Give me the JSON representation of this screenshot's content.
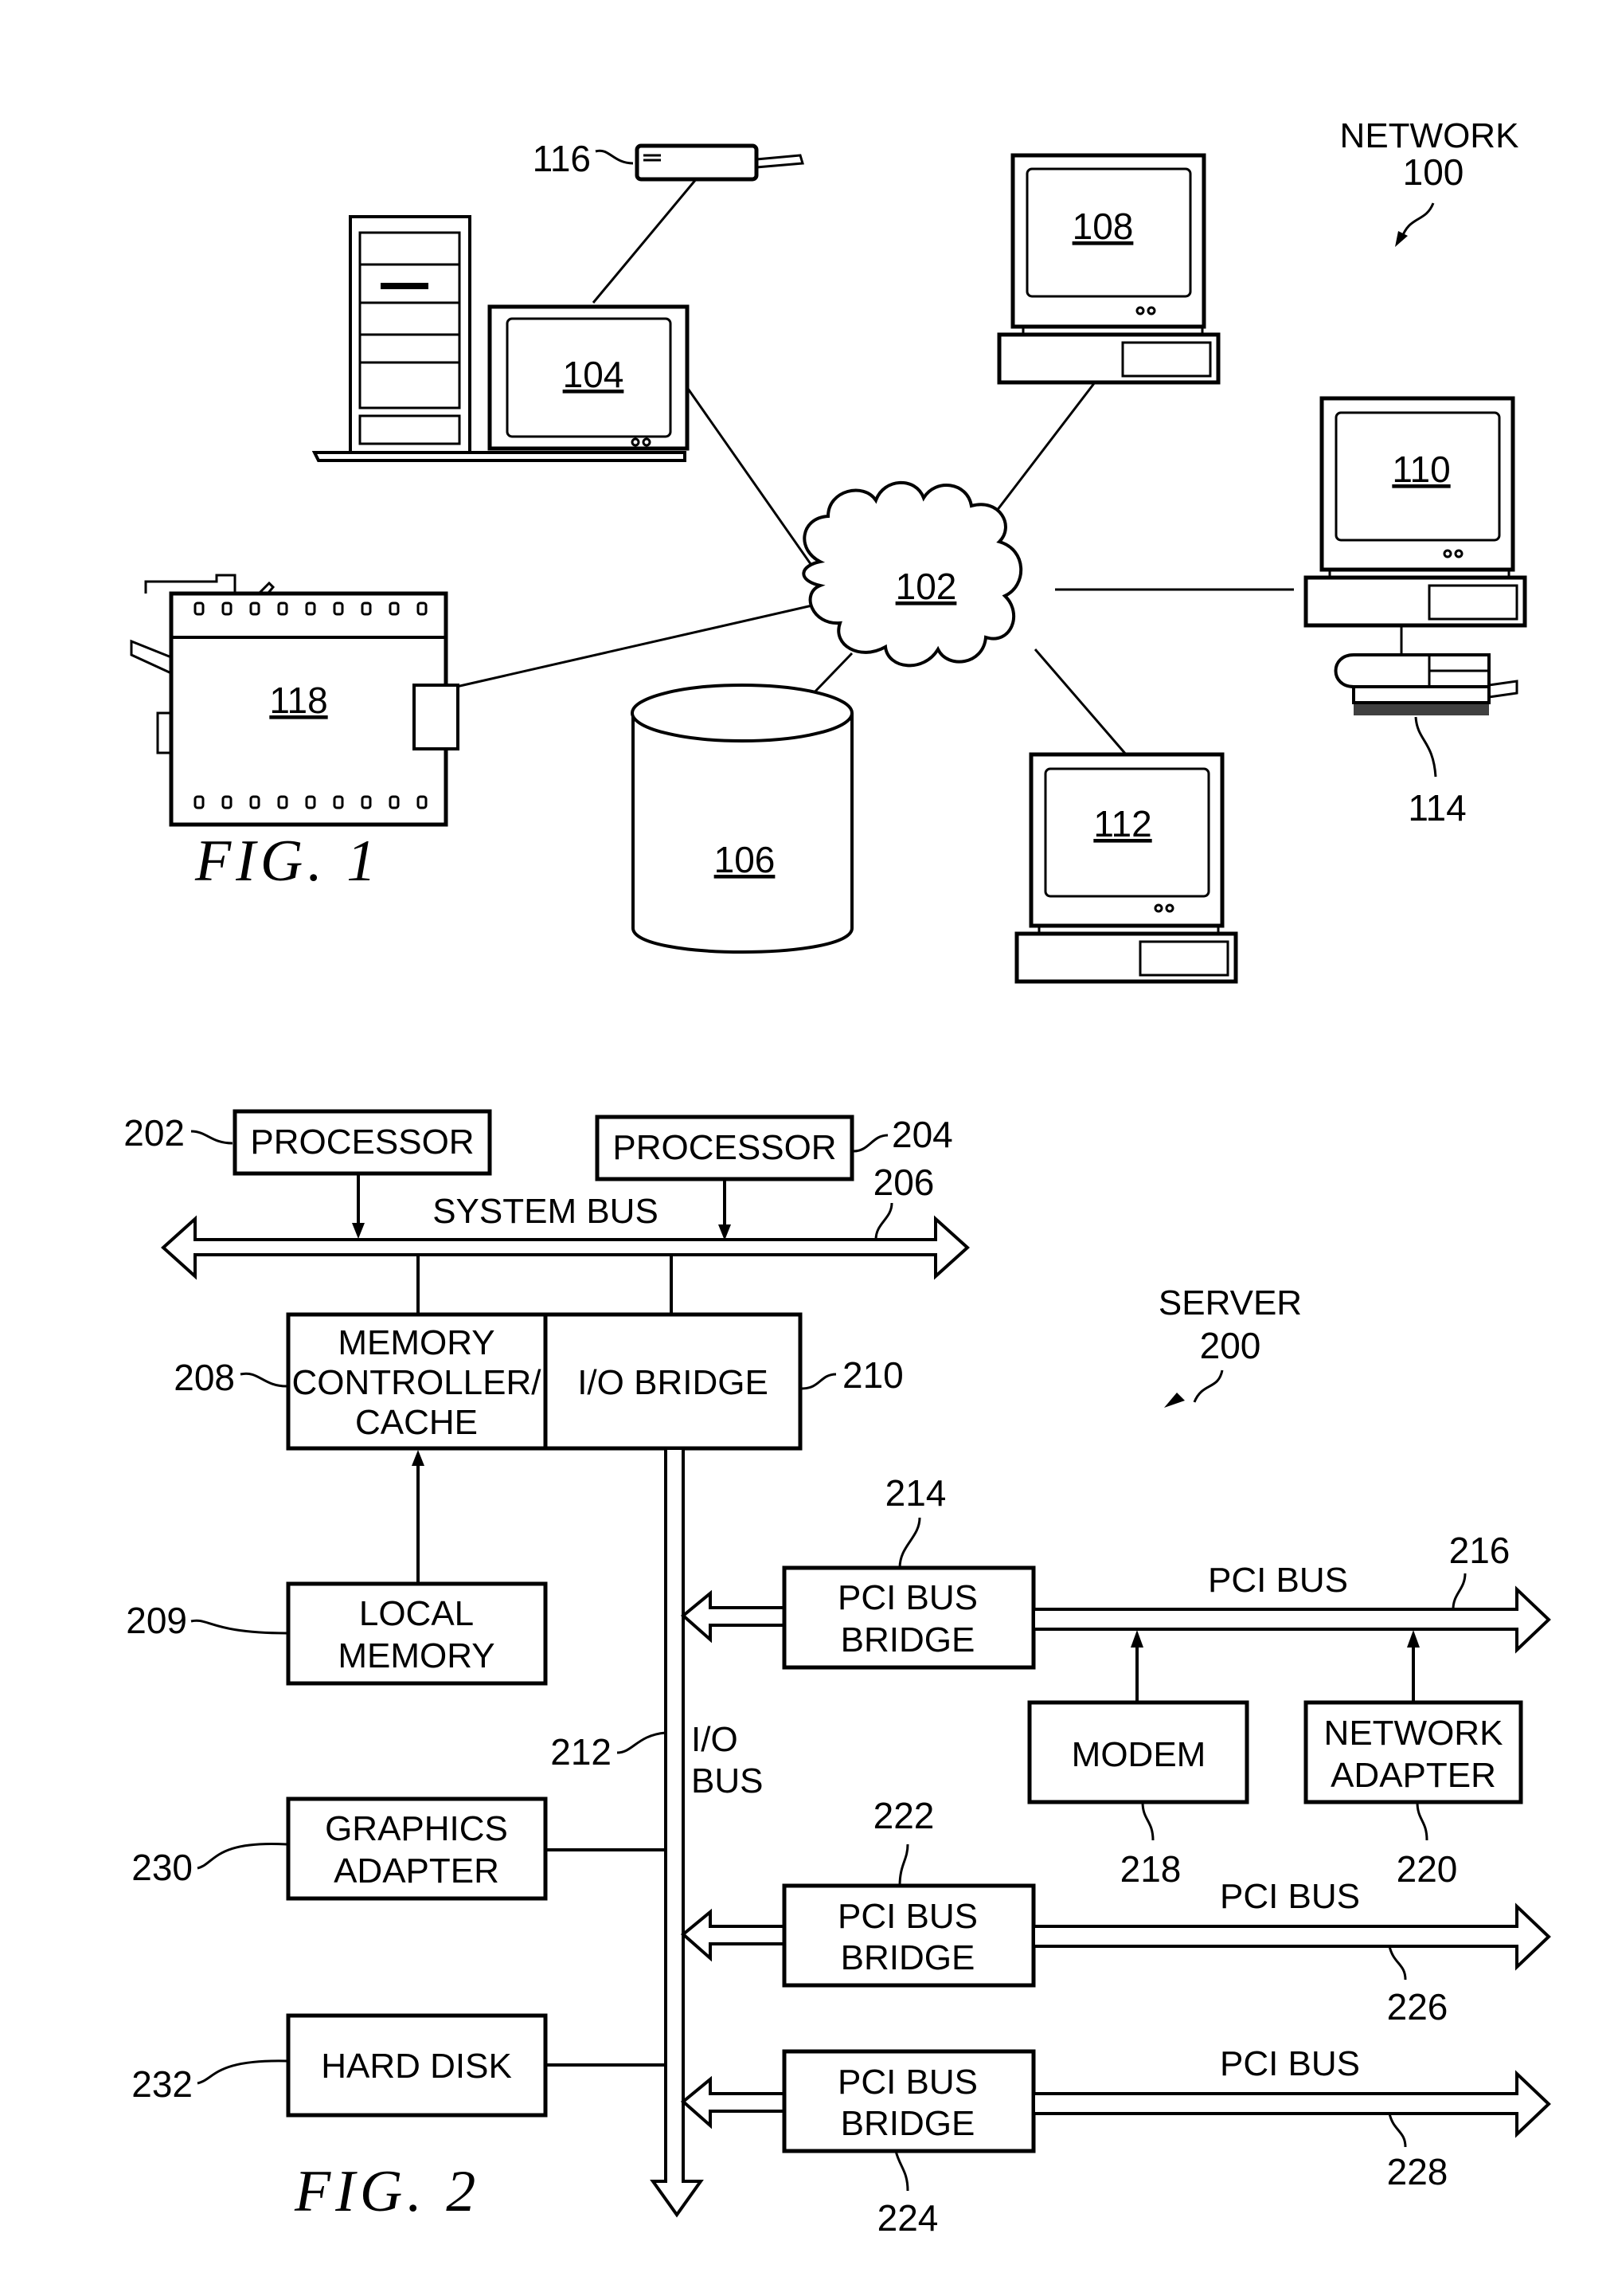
{
  "figure1": {
    "caption": "FIG.  1",
    "title_line1": "NETWORK",
    "title_line2": "100",
    "nodes": {
      "network": "102",
      "server": "104",
      "storage": "106",
      "client_a": "108",
      "client_b": "110",
      "client_c": "112",
      "scanner": "114",
      "modem": "116",
      "printer": "118"
    }
  },
  "figure2": {
    "caption": "FIG.  2",
    "title_line1": "SERVER",
    "title_line2": "200",
    "blocks": {
      "processor_a": {
        "ref": "202",
        "label": "PROCESSOR"
      },
      "processor_b": {
        "ref": "204",
        "label": "PROCESSOR"
      },
      "memory_controller": {
        "ref": "208",
        "lines": [
          "MEMORY",
          "CONTROLLER/",
          "CACHE"
        ]
      },
      "io_bridge": {
        "ref": "210",
        "label": "I/O  BRIDGE"
      },
      "local_memory": {
        "ref": "209",
        "lines": [
          "LOCAL",
          "MEMORY"
        ]
      },
      "graphics_adapter": {
        "ref": "230",
        "lines": [
          "GRAPHICS",
          "ADAPTER"
        ]
      },
      "hard_disk": {
        "ref": "232",
        "label": "HARD  DISK"
      },
      "pci_bridge_a": {
        "ref": "214",
        "lines": [
          "PCI  BUS",
          "BRIDGE"
        ]
      },
      "pci_bridge_b": {
        "ref": "222",
        "lines": [
          "PCI  BUS",
          "BRIDGE"
        ]
      },
      "pci_bridge_c": {
        "ref": "224",
        "lines": [
          "PCI  BUS",
          "BRIDGE"
        ]
      },
      "modem": {
        "ref": "218",
        "label": "MODEM"
      },
      "network_adapter": {
        "ref": "220",
        "lines": [
          "NETWORK",
          "ADAPTER"
        ]
      }
    },
    "buses": {
      "system_bus": {
        "ref": "206",
        "label": "SYSTEM  BUS"
      },
      "io_bus": {
        "ref": "212",
        "lines": [
          "I/O",
          "BUS"
        ]
      },
      "pci_bus_a": {
        "ref": "216",
        "label": "PCI  BUS"
      },
      "pci_bus_b": {
        "ref": "226",
        "label": "PCI  BUS"
      },
      "pci_bus_c": {
        "ref": "228",
        "label": "PCI  BUS"
      }
    }
  }
}
